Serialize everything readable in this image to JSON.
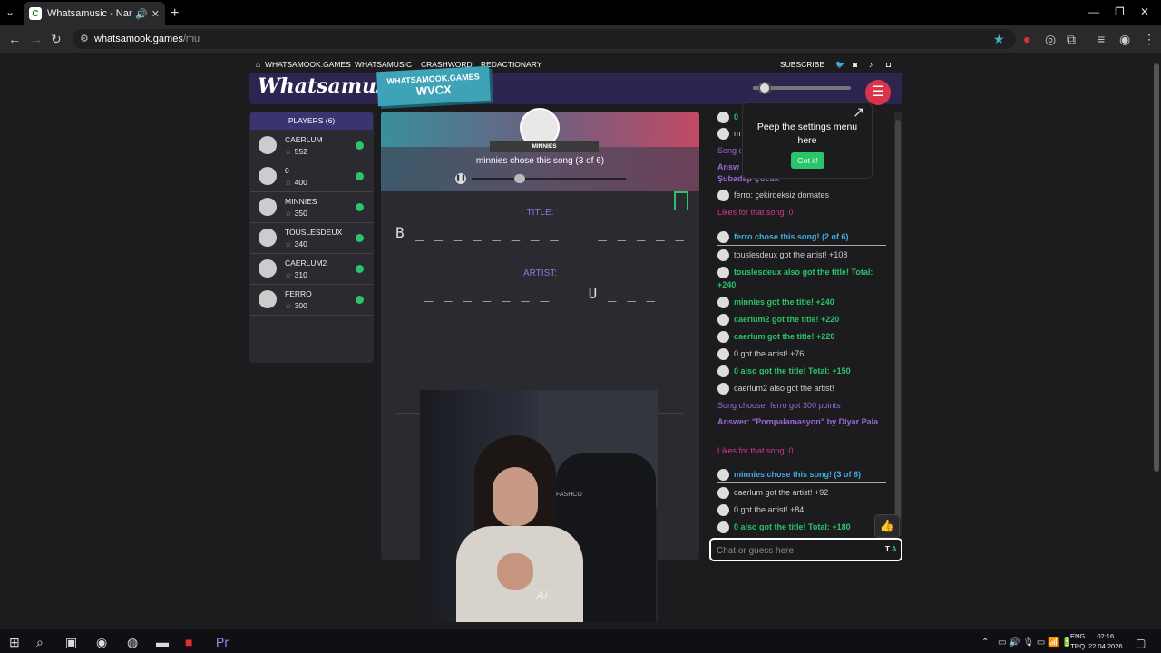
{
  "browser": {
    "tab_title": "Whatsamusic - Name That",
    "url_host": "whatsamook.games",
    "url_path": "/mu"
  },
  "site_nav": {
    "home": "WHATSAMOOK.GAMES",
    "whatsamusic": "WHATSAMUSIC",
    "crashword": "CRASHWORD",
    "redactionary": "REDACTIONARY",
    "subscribe": "SUBSCRIBE"
  },
  "header": {
    "logo": "Whatsamusic",
    "room_site": "WHATSAMOOK.GAMES",
    "room_code": "WVCX"
  },
  "players": {
    "title": "PLAYERS (6)",
    "list": [
      {
        "name": "CAERLUM",
        "score": "552"
      },
      {
        "name": "0",
        "score": "400"
      },
      {
        "name": "MINNIES",
        "score": "350"
      },
      {
        "name": "TOUSLESDEUX",
        "score": "340"
      },
      {
        "name": "CAERLUM2",
        "score": "310"
      },
      {
        "name": "FERRO",
        "score": "300"
      }
    ]
  },
  "game": {
    "chooser_name": "MINNIES",
    "chose_text": "minnies chose this song (3 of 6)",
    "title_label": "TITLE:",
    "title_hint": "B _ _ _ _ _ _ _ _    _ _ _ _ _",
    "artist_label": "ARTIST:",
    "artist_hint": "_ _ _ _ _ _ _    U _ _ _",
    "progress": 0.31
  },
  "tooltip": {
    "text": "Peep the settings menu here",
    "button": "Got it!"
  },
  "chat": {
    "lines": [
      {
        "text": "0",
        "cls": "g",
        "avatar": true
      },
      {
        "text": "m",
        "cls": "w",
        "avatar": true
      },
      {
        "text": "Song c",
        "cls": "p",
        "avatar": false
      },
      {
        "text": "Answ",
        "cls": "pb",
        "avatar": false
      },
      {
        "text": "Şubadap Çocuk",
        "cls": "pb",
        "avatar": false
      },
      {
        "text": "ferro: çekirdeksiz domates",
        "cls": "w",
        "avatar": true
      },
      {
        "text": "Likes for that song: 0",
        "cls": "m",
        "avatar": false
      },
      {
        "text": "ferro chose this song! (2 of 6)",
        "cls": "b",
        "avatar": true
      },
      {
        "text": "touslesdeux got the artist! +108",
        "cls": "w",
        "avatar": true
      },
      {
        "text": "touslesdeux also got the title! Total: +240",
        "cls": "g",
        "avatar": true
      },
      {
        "text": "minnies got the title! +240",
        "cls": "g",
        "avatar": true
      },
      {
        "text": "caerlum2 got the title! +220",
        "cls": "g",
        "avatar": true
      },
      {
        "text": "caerlum got the title! +220",
        "cls": "g",
        "avatar": true
      },
      {
        "text": "0 got the artist! +76",
        "cls": "w",
        "avatar": true
      },
      {
        "text": "0 also got the title! Total: +150",
        "cls": "g",
        "avatar": true
      },
      {
        "text": "caerlum2 also got the artist!",
        "cls": "w",
        "avatar": true
      },
      {
        "text": "Song chooser ferro got 300 points",
        "cls": "p",
        "avatar": false
      },
      {
        "text": "Answer: \"Pompalamasyon\" by Diyar Pala",
        "cls": "pb",
        "avatar": false
      },
      {
        "text": "Likes for that song: 0",
        "cls": "m",
        "avatar": false
      },
      {
        "text": "minnies chose this song! (3 of 6)",
        "cls": "b",
        "avatar": true
      },
      {
        "text": "caerlum got the artist! +92",
        "cls": "w",
        "avatar": true
      },
      {
        "text": "0 got the artist! +84",
        "cls": "w",
        "avatar": true
      },
      {
        "text": "0 also got the title! Total: +180",
        "cls": "g",
        "avatar": true
      }
    ],
    "input_placeholder": "Chat or guess here",
    "text_size_t": "T",
    "text_size_a": "A"
  },
  "webcam": {
    "overlay_text": "Ai",
    "chair_brand": "FASHCO"
  },
  "taskbar": {
    "lang_top": "ENG",
    "lang_bottom": "TRQ",
    "time": "02:16",
    "date": "22.04.2026"
  },
  "colors": {
    "green": "#2ac46b",
    "purple": "#9a6ad8",
    "blue": "#3cb0e0",
    "magenta": "#d43a8a"
  }
}
